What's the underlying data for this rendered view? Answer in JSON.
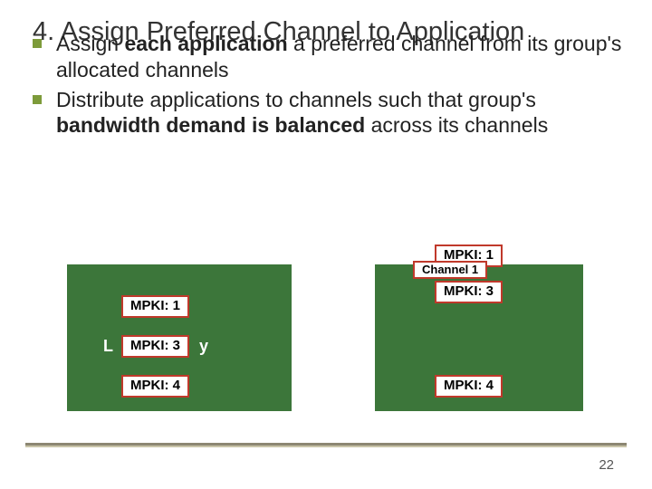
{
  "title": "4. Assign Preferred Channel to Application",
  "bullets": {
    "b1_pre": "Assign ",
    "b1_em": "each application",
    "b1_post": " a preferred channel from its group's allocated channels",
    "b2_pre": "Distribute applications to channels such that group's ",
    "b2_em": "bandwidth demand is balanced",
    "b2_post": " across its channels"
  },
  "left_box": {
    "badges": {
      "a": "MPKI: 1",
      "b": "MPKI: 3",
      "c": "MPKI: 4"
    },
    "side_letters": {
      "l": "L",
      "r": "y"
    }
  },
  "right_box": {
    "top_badge": "MPKI: 1",
    "channel_label": "Channel 1",
    "second_badge": "MPKI: 3",
    "bottom_badge": "MPKI: 4"
  },
  "page_number": "22"
}
